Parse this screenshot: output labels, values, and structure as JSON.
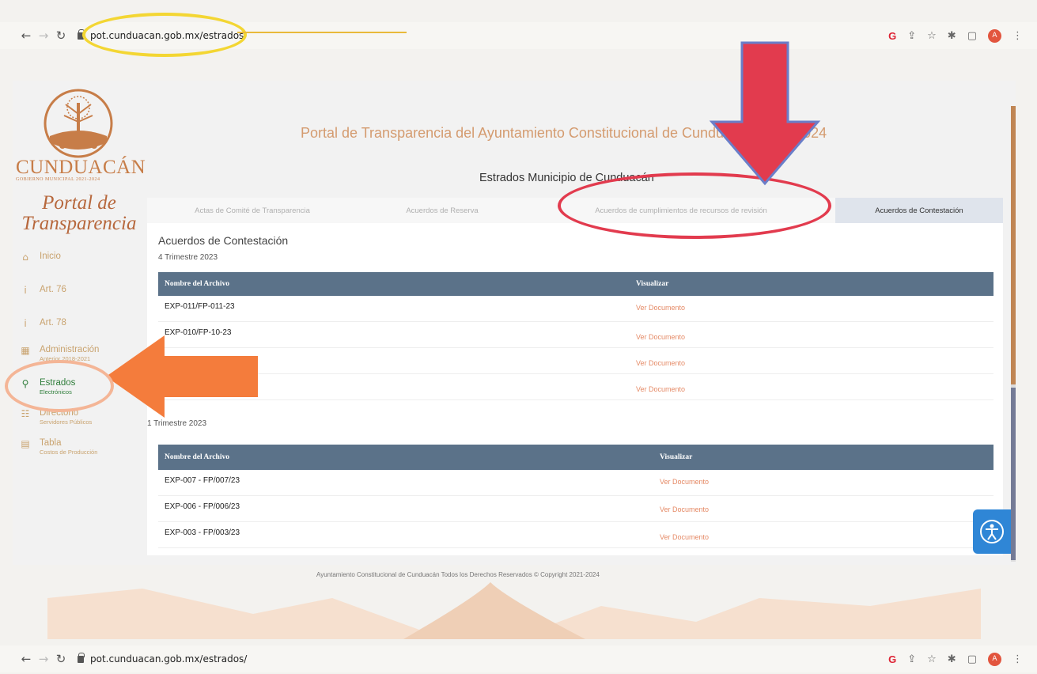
{
  "browser": {
    "url": "pot.cunduacan.gob.mx/estrados/",
    "icons": [
      "back-icon",
      "forward-icon",
      "reload-icon",
      "google-icon",
      "share-icon",
      "star-icon",
      "extensions-icon",
      "sidepanel-icon",
      "profile-icon",
      "menu-icon"
    ],
    "profile_initial": "A"
  },
  "sidebar": {
    "brand": "CUNDUACÁN",
    "brand_sub": "GOBIERNO MUNICIPAL 2021-2024",
    "portal_title_1": "Portal de",
    "portal_title_2": "Transparencia",
    "items": [
      {
        "label": "Inicio",
        "sub": "",
        "icon": "home-icon"
      },
      {
        "label": "Art. 76",
        "sub": "",
        "icon": "info-icon"
      },
      {
        "label": "Art. 78",
        "sub": "",
        "icon": "info-icon"
      },
      {
        "label": "Administración",
        "sub": "Anterior 2018-2021",
        "icon": "calendar-icon"
      },
      {
        "label": "Estrados",
        "sub": "Electrónicos",
        "icon": "search-icon"
      },
      {
        "label": "Directorio",
        "sub": "Servidores Públicos",
        "icon": "people-icon"
      },
      {
        "label": "Tabla",
        "sub": "Costos de Producción",
        "icon": "table-icon"
      }
    ]
  },
  "header": {
    "title": "Portal de Transparencia del Ayuntamiento Constitucional de Cunduacán 2021-2024",
    "section": "Estrados Municipio de Cunduacán"
  },
  "tabs": [
    {
      "label": "Actas de Comité de Transparencia"
    },
    {
      "label": "Acuerdos de Reserva"
    },
    {
      "label": "Acuerdos de cumplimientos de recursos de revisión"
    },
    {
      "label": "Acuerdos de Contestación"
    }
  ],
  "content": {
    "heading": "Acuerdos de Contestación",
    "col_name": "Nombre del Archivo",
    "col_view": "Visualizar",
    "groups": [
      {
        "period": "4 Trimestre 2023",
        "rows": [
          {
            "name": "EXP-011/FP-011-23",
            "link": "Ver Documento"
          },
          {
            "name": "EXP-010/FP-10-23",
            "link": "Ver Documento"
          },
          {
            "name": "",
            "link": "Ver Documento"
          },
          {
            "name": "",
            "link": "Ver Documento"
          }
        ]
      },
      {
        "period": "1 Trimestre 2023",
        "rows": [
          {
            "name": "EXP-007 - FP/007/23",
            "link": "Ver Documento"
          },
          {
            "name": "EXP-006 - FP/006/23",
            "link": "Ver Documento"
          },
          {
            "name": "EXP-003 - FP/003/23",
            "link": "Ver Documento"
          }
        ]
      }
    ]
  },
  "footer": "Ayuntamiento Constitucional de Cunduacán Todos los Derechos Reservados © Copyright 2021-2024",
  "colors": {
    "table_header": "#5b7289",
    "link": "#e58a66",
    "brand": "#c77d48",
    "annotation_yellow": "#f3d633",
    "annotation_red": "#e23b4e",
    "annotation_orange": "#f47c3c",
    "accessibility": "#2f86d6"
  }
}
